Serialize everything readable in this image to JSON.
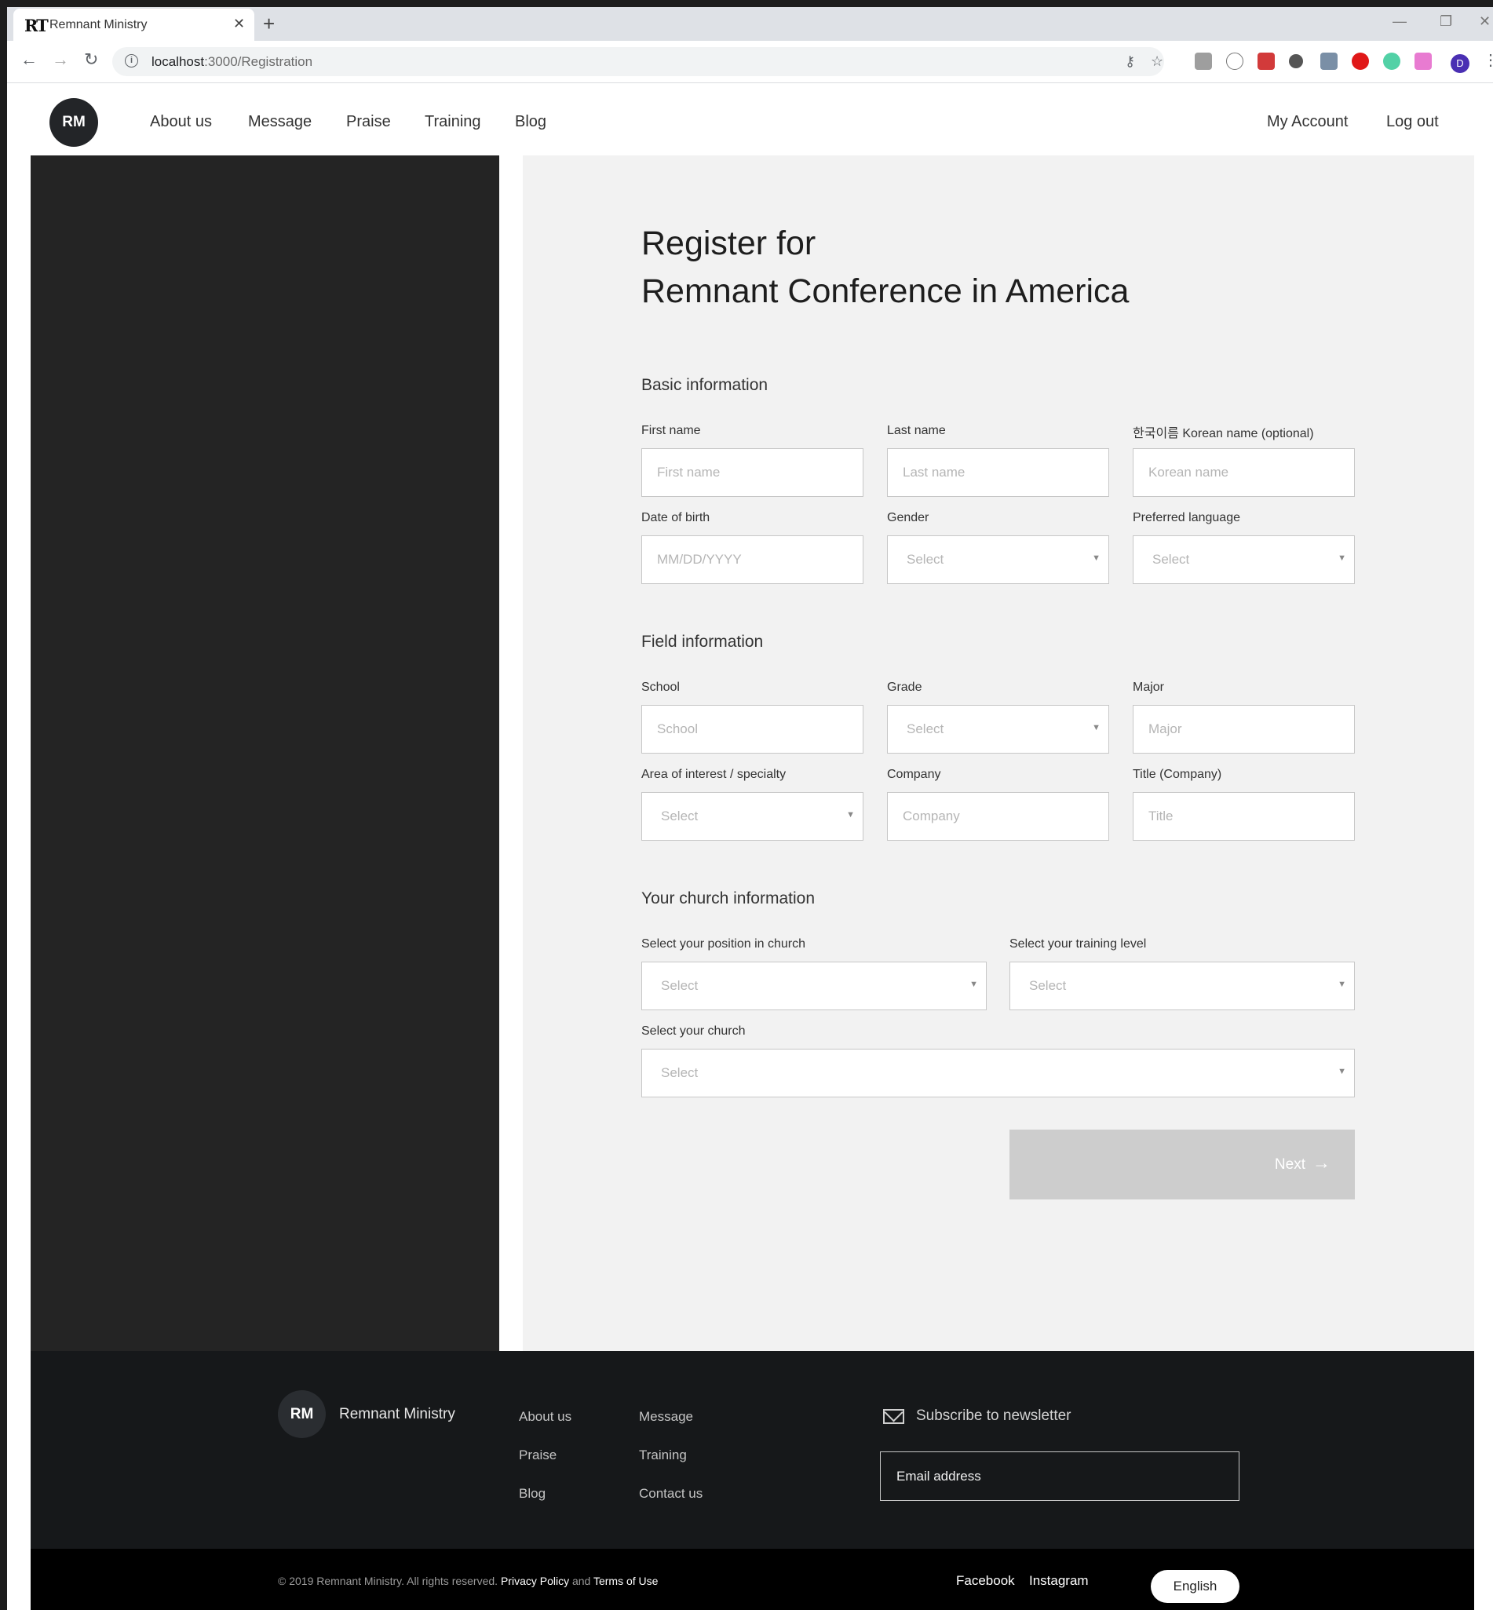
{
  "browser": {
    "tab_title": "Remnant Ministry",
    "tab_favicon": "RT",
    "url_host": "localhost",
    "url_rest": ":3000/Registration",
    "profile_initial": "D"
  },
  "header": {
    "logo": "RM",
    "nav": [
      "About us",
      "Message",
      "Praise",
      "Training",
      "Blog"
    ],
    "account": "My Account",
    "logout": "Log out"
  },
  "form": {
    "title_line1": "Register for",
    "title_line2": "Remnant Conference in America",
    "basic": {
      "title": "Basic information",
      "first_name_label": "First name",
      "first_name_placeholder": "First name",
      "last_name_label": "Last name",
      "last_name_placeholder": "Last name",
      "korean_name_label": "한국이름 Korean name (optional)",
      "korean_name_placeholder": "Korean name",
      "dob_label": "Date of birth",
      "dob_placeholder": "MM/DD/YYYY",
      "gender_label": "Gender",
      "gender_value": "Select",
      "language_label": "Preferred language",
      "language_value": "Select"
    },
    "field": {
      "title": "Field information",
      "school_label": "School",
      "school_placeholder": "School",
      "grade_label": "Grade",
      "grade_value": "Select",
      "major_label": "Major",
      "major_placeholder": "Major",
      "interest_label": "Area of interest / specialty",
      "interest_value": "Select",
      "company_label": "Company",
      "company_placeholder": "Company",
      "title_label": "Title (Company)",
      "title_placeholder": "Title"
    },
    "church": {
      "title": "Your church information",
      "position_label": "Select your position in church",
      "position_value": "Select",
      "training_label": "Select your training level",
      "training_value": "Select",
      "church_label": "Select your church",
      "church_value": "Select"
    },
    "next_label": "Next"
  },
  "footer": {
    "logo": "RM",
    "brand": "Remnant Ministry",
    "links": [
      "About us",
      "Message",
      "Praise",
      "Training",
      "Blog",
      "Contact us"
    ],
    "newsletter_title": "Subscribe to newsletter",
    "email_placeholder": "Email address",
    "copyright": "© 2019 Remnant Ministry. All rights reserved.",
    "privacy": "Privacy Policy",
    "and": "and",
    "terms": "Terms of Use",
    "facebook": "Facebook",
    "instagram": "Instagram",
    "language": "English"
  }
}
